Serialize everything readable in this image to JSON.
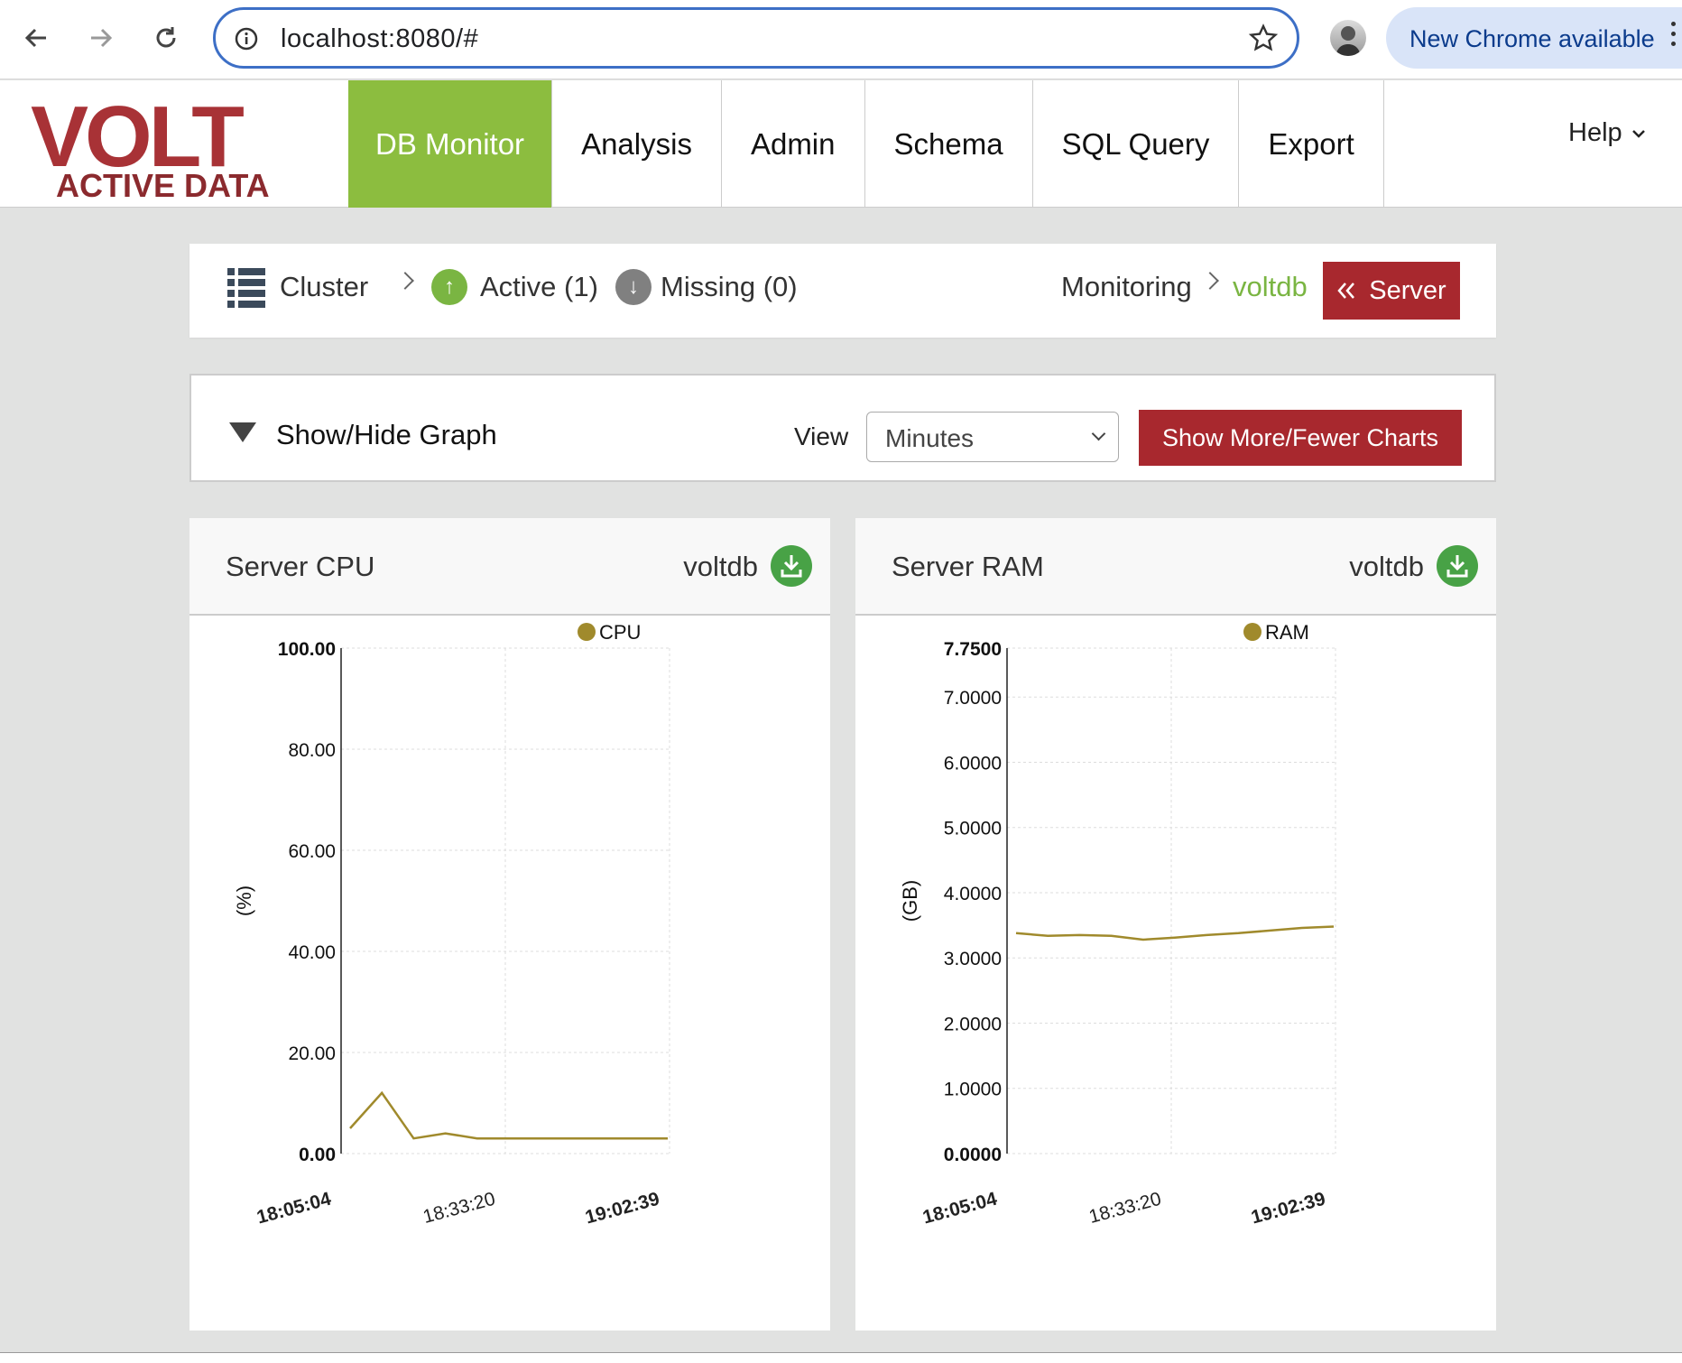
{
  "browser": {
    "url": "localhost:8080/#",
    "update_notice": "New Chrome available"
  },
  "app": {
    "logo_main": "VOLT",
    "logo_sub": "ACTIVE DATA",
    "menu": [
      {
        "label": "DB Monitor",
        "active": true
      },
      {
        "label": "Analysis"
      },
      {
        "label": "Admin"
      },
      {
        "label": "Schema"
      },
      {
        "label": "SQL Query"
      },
      {
        "label": "Export"
      }
    ],
    "help": "Help"
  },
  "breadcrumb": {
    "cluster": "Cluster",
    "active": "Active (1)",
    "missing": "Missing (0)",
    "monitoring": "Monitoring",
    "db": "voltdb",
    "server_button": "Server"
  },
  "graph_controls": {
    "toggle_label": "Show/Hide Graph",
    "view_label": "View",
    "view_selected": "Minutes",
    "more_button": "Show More/Fewer Charts"
  },
  "colors": {
    "accent_green": "#8cbd3f",
    "brand_red": "#a8282e",
    "series": "#a08a2c"
  },
  "chart_data": [
    {
      "type": "line",
      "title": "Server CPU",
      "host": "voltdb",
      "ylabel": "(%)",
      "ylim": [
        0,
        100
      ],
      "yticks": [
        "0.00",
        "20.00",
        "40.00",
        "60.00",
        "80.00",
        "100.00"
      ],
      "xticks": [
        "18:05:04",
        "18:33:20",
        "19:02:39"
      ],
      "series": [
        {
          "name": "CPU",
          "values": [
            5,
            12,
            3,
            4,
            3,
            3,
            3,
            3,
            3,
            3,
            3
          ]
        }
      ]
    },
    {
      "type": "line",
      "title": "Server RAM",
      "host": "voltdb",
      "ylabel": "(GB)",
      "ylim": [
        0,
        7.75
      ],
      "yticks": [
        "0.0000",
        "1.0000",
        "2.0000",
        "3.0000",
        "4.0000",
        "5.0000",
        "6.0000",
        "7.0000",
        "7.7500"
      ],
      "xticks": [
        "18:05:04",
        "18:33:20",
        "19:02:39"
      ],
      "series": [
        {
          "name": "RAM",
          "values": [
            3.38,
            3.34,
            3.35,
            3.34,
            3.28,
            3.31,
            3.35,
            3.38,
            3.42,
            3.46,
            3.48
          ]
        }
      ]
    }
  ]
}
